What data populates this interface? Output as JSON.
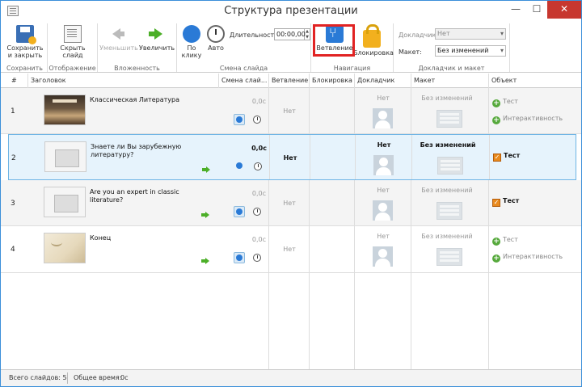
{
  "window": {
    "title": "Структура презентации",
    "min": "—",
    "max": "☐",
    "close": "✕"
  },
  "ribbon": {
    "save": {
      "save_close": "Сохранить и закрыть",
      "group": "Сохранить"
    },
    "display": {
      "hide_slide": "Скрыть слайд",
      "group": "Отображение"
    },
    "nesting": {
      "decrease": "Уменьшить",
      "increase": "Увеличить",
      "group": "Вложенность"
    },
    "transition": {
      "on_click": "По клику",
      "auto": "Авто",
      "duration_label": "Длительность:",
      "duration_value": "00:00,00",
      "group": "Смена слайда"
    },
    "navigation": {
      "branching": "Ветвление",
      "lock": "Блокировка",
      "group": "Навигация"
    },
    "narrator_layout": {
      "narrator_label": "Докладчик:",
      "narrator_value": "Нет",
      "layout_label": "Макет:",
      "layout_value": "Без изменений",
      "group": "Докладчик и макет"
    }
  },
  "columns": {
    "num": "#",
    "title": "Заголовок",
    "transition": "Смена слай...",
    "branching": "Ветвление",
    "lock": "Блокировка",
    "narrator": "Докладчик",
    "layout": "Макет",
    "object": "Объект"
  },
  "rows": [
    {
      "num": "1",
      "title": "Классическая Литература",
      "time": "0,0с",
      "branch": "Нет",
      "narrator": "Нет",
      "layout": "Без изменений",
      "objects": [
        "Тест",
        "Интерактивность"
      ]
    },
    {
      "num": "2",
      "title": "Знаете ли Вы зарубежную литературу?",
      "time": "0,0с",
      "branch": "Нет",
      "narrator": "Нет",
      "layout": "Без изменений",
      "objects": [
        "Тест"
      ]
    },
    {
      "num": "3",
      "title": "Are you an expert in classic literature?",
      "time": "0,0с",
      "branch": "Нет",
      "narrator": "Нет",
      "layout": "Без изменений",
      "objects": [
        "Тест"
      ]
    },
    {
      "num": "4",
      "title": "Конец",
      "time": "0,0с",
      "branch": "Нет",
      "narrator": "Нет",
      "layout": "Без изменений",
      "objects": [
        "Тест",
        "Интерактивность"
      ]
    }
  ],
  "status": {
    "total": "Всего слайдов: 5",
    "time": "Общее время:",
    "time_value": "0с"
  }
}
